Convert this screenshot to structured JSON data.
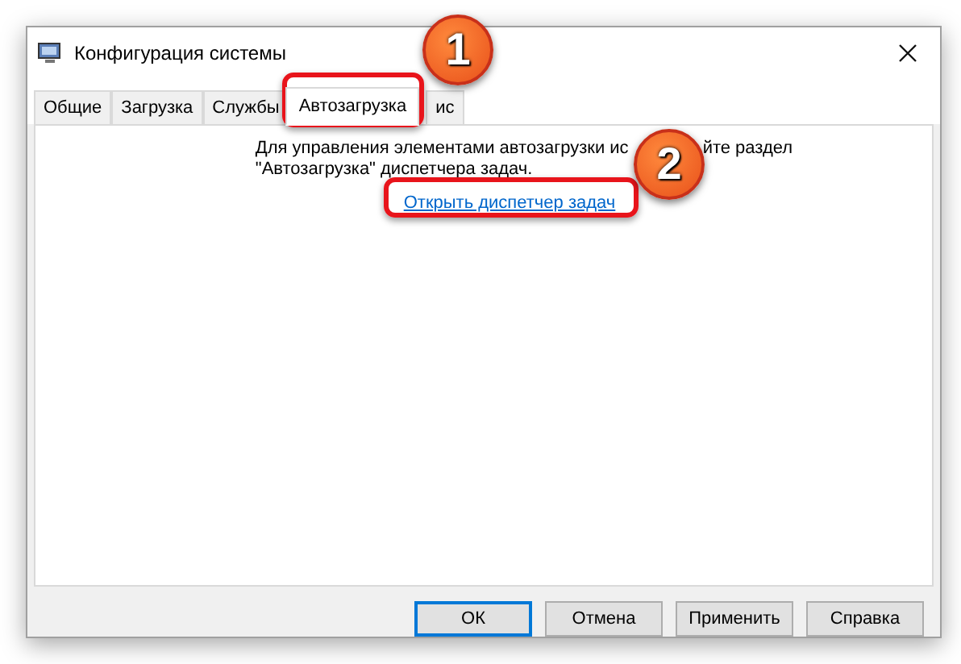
{
  "window": {
    "title": "Конфигурация системы"
  },
  "tabs": [
    {
      "label": "Общие",
      "selected": false
    },
    {
      "label": "Загрузка",
      "selected": false
    },
    {
      "label": "Службы",
      "selected": false
    },
    {
      "label": "Автозагрузка",
      "selected": true
    },
    {
      "label": "ис",
      "selected": false
    }
  ],
  "panel": {
    "text_line_1_start": "Для управления элементами автозагрузки ис",
    "text_line_1_end": "йте раздел",
    "text_line_2": "\"Автозагрузка\" диспетчера задач.",
    "link": "Открыть диспетчер задач"
  },
  "buttons": [
    {
      "label": "ОК",
      "default": true
    },
    {
      "label": "Отмена",
      "default": false
    },
    {
      "label": "Применить",
      "default": false
    },
    {
      "label": "Справка",
      "default": false
    }
  ],
  "callouts": [
    {
      "number": "1"
    },
    {
      "number": "2"
    }
  ]
}
